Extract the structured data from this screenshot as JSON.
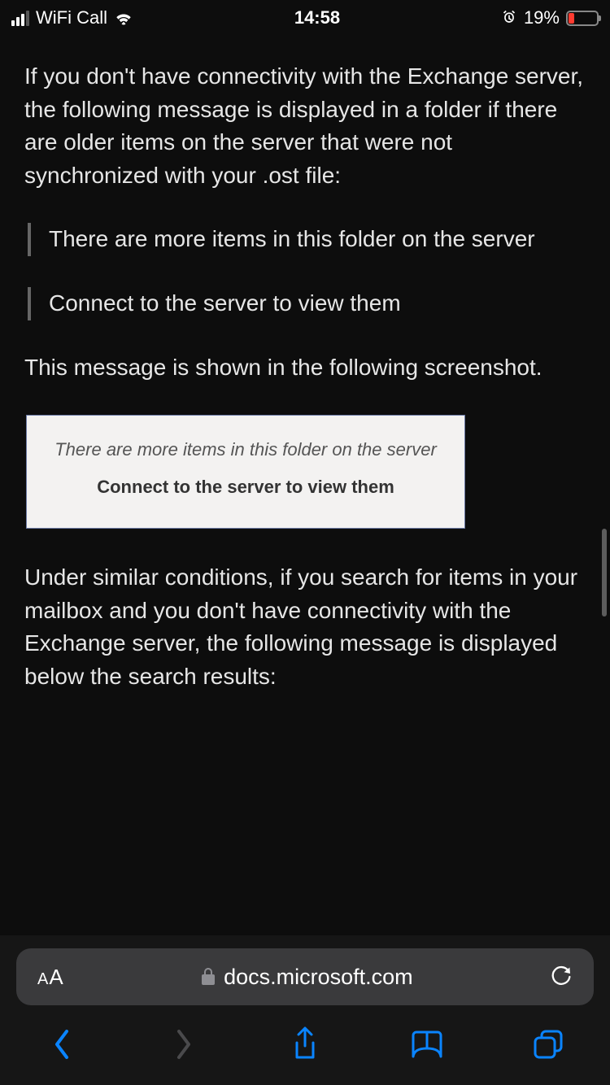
{
  "status_bar": {
    "carrier": "WiFi Call",
    "time": "14:58",
    "battery_pct": "19%"
  },
  "content": {
    "para1": "If you don't have connectivity with the Exchange server, the following message is displayed in a folder if there are older items on the server that were not synchronized with your .ost file:",
    "quote1": "There are more items in this folder on the server",
    "quote2": "Connect to the server to view them",
    "para2": "This message is shown in the following screenshot.",
    "shot_line1": "There are more items in this folder on the server",
    "shot_line2": "Connect to the server to view them",
    "para3": "Under similar conditions, if you search for items in your mailbox and you don't have connectivity with the Exchange server, the following message is displayed below the search results:"
  },
  "chrome": {
    "aa": "AA",
    "url": "docs.microsoft.com"
  }
}
